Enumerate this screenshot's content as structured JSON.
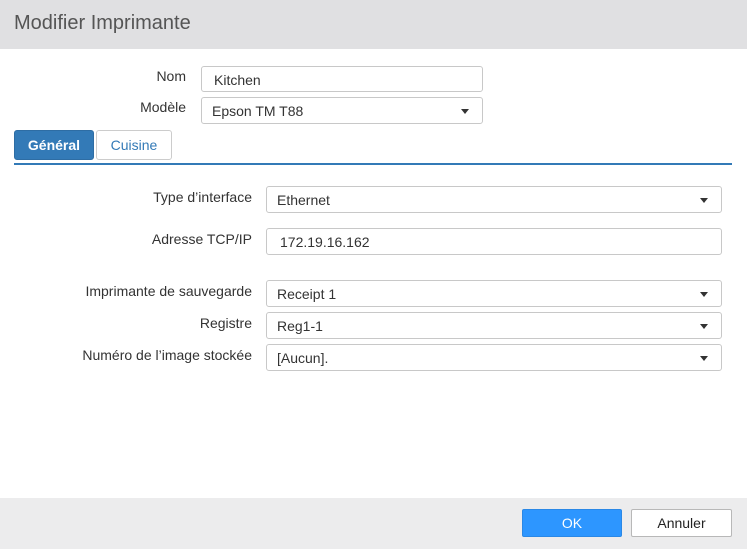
{
  "dialog": {
    "title": "Modifier Imprimante"
  },
  "printer": {
    "name_label": "Nom",
    "name_value": "Kitchen",
    "model_label": "Modèle",
    "model_value": "Epson TM T88"
  },
  "tabs": [
    {
      "label": "Général",
      "active": true
    },
    {
      "label": "Cuisine",
      "active": false
    }
  ],
  "general": {
    "interface_type_label": "Type d’interface",
    "interface_type_value": "Ethernet",
    "ip_label": "Adresse TCP/IP",
    "ip_value": "172.19.16.162",
    "backup_printer_label": "Imprimante de sauvegarde",
    "backup_printer_value": "Receipt 1",
    "register_label": "Registre",
    "register_value": "Reg1-1",
    "stored_image_label": "Numéro de l’image stockée",
    "stored_image_value": "[Aucun]."
  },
  "footer": {
    "ok_label": "OK",
    "cancel_label": "Annuler"
  },
  "colors": {
    "accent": "#337ab7",
    "ok_button": "#2d96ff",
    "title_bar": "#e0e0e2",
    "footer": "#ececed"
  },
  "icons": {
    "dropdown": "chevron-down-icon"
  }
}
